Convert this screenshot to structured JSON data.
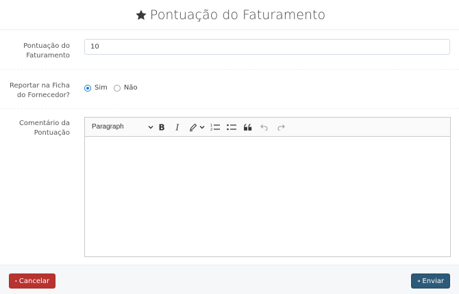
{
  "header": {
    "title": "Pontuação do Faturamento",
    "icon": "star-icon"
  },
  "form": {
    "score": {
      "label_line1": "Pontuação do",
      "label_line2": "Faturamento",
      "value": "10"
    },
    "report": {
      "label_line1": "Reportar na Ficha",
      "label_line2": "do Fornecedor?",
      "options": [
        {
          "label": "Sim",
          "checked": true
        },
        {
          "label": "Não",
          "checked": false
        }
      ]
    },
    "comment": {
      "label_line1": "Comentário da",
      "label_line2": "Pontuação",
      "toolbar": {
        "heading_select": "Paragraph",
        "buttons": [
          "bold-icon",
          "italic-icon",
          "highlight-icon",
          "numbered-list-icon",
          "bulleted-list-icon",
          "quote-icon",
          "undo-icon",
          "redo-icon"
        ]
      },
      "content": ""
    }
  },
  "footer": {
    "cancel_label": "Cancelar",
    "send_label": "Enviar"
  },
  "colors": {
    "cancel": "#b83330",
    "send": "#2c5a78",
    "radio_accent": "#1c7bd4"
  }
}
